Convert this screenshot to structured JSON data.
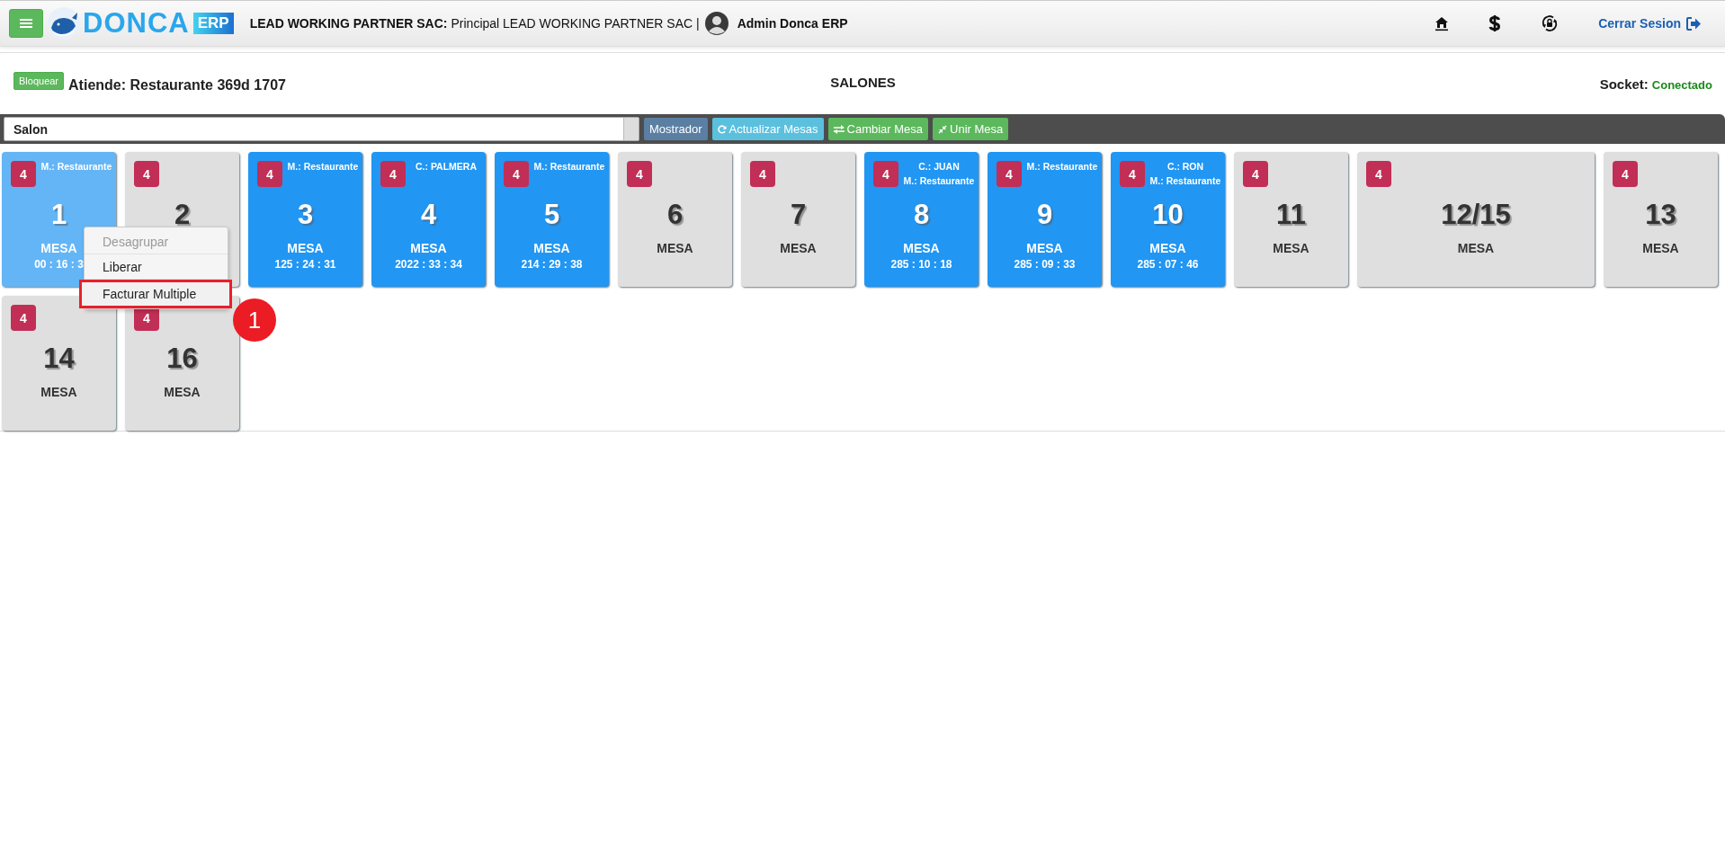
{
  "header": {
    "logo_text": "DONCA",
    "logo_badge": "ERP",
    "company_label": "LEAD WORKING PARTNER SAC:",
    "company_detail": "Principal LEAD WORKING PARTNER SAC |",
    "user": "Admin Donca ERP",
    "logout": "Cerrar Sesion"
  },
  "panel": {
    "lock_button": "Bloquear",
    "attendant": "Atiende: Restaurante 369d 1707",
    "title": "SALONES",
    "socket_label": "Socket:",
    "socket_status": "Conectado",
    "socket_connected": true
  },
  "toolbar": {
    "salon_select": "Salon",
    "buttons": [
      {
        "label": "Mostrador",
        "kind": "plain"
      },
      {
        "label": "Actualizar Mesas",
        "kind": "refresh"
      },
      {
        "label": "Cambiar Mesa",
        "kind": "exchange"
      },
      {
        "label": "Unir Mesa",
        "kind": "merge"
      }
    ]
  },
  "tables": [
    {
      "number": "1",
      "label": "MESA",
      "seats": "4",
      "occupied": true,
      "selected": true,
      "wide": false,
      "notes": [
        "M.: Restaurante"
      ],
      "time": "00 : 16 : 3"
    },
    {
      "number": "2",
      "seats": "4",
      "occupied": false,
      "selected": false,
      "wide": false
    },
    {
      "number": "3",
      "label": "MESA",
      "seats": "4",
      "occupied": true,
      "selected": false,
      "wide": false,
      "notes": [
        "M.: Restaurante"
      ],
      "time": "125 : 24 : 31"
    },
    {
      "number": "4",
      "label": "MESA",
      "seats": "4",
      "occupied": true,
      "selected": false,
      "wide": false,
      "notes": [
        "C.: PALMERA"
      ],
      "time": "2022 : 33 : 34"
    },
    {
      "number": "5",
      "label": "MESA",
      "seats": "4",
      "occupied": true,
      "selected": false,
      "wide": false,
      "notes": [
        "M.: Restaurante"
      ],
      "time": "214 : 29 : 38"
    },
    {
      "number": "6",
      "label": "MESA",
      "seats": "4",
      "occupied": false,
      "selected": false,
      "wide": false
    },
    {
      "number": "7",
      "label": "MESA",
      "seats": "4",
      "occupied": false,
      "selected": false,
      "wide": false
    },
    {
      "number": "8",
      "label": "MESA",
      "seats": "4",
      "occupied": true,
      "selected": false,
      "wide": false,
      "notes": [
        "C.: JUAN",
        "M.: Restaurante"
      ],
      "time": "285 : 10 : 18"
    },
    {
      "number": "9",
      "label": "MESA",
      "seats": "4",
      "occupied": true,
      "selected": false,
      "wide": false,
      "notes": [
        "M.: Restaurante"
      ],
      "time": "285 : 09 : 33"
    },
    {
      "number": "10",
      "label": "MESA",
      "seats": "4",
      "occupied": true,
      "selected": false,
      "wide": false,
      "notes": [
        "C.: RON",
        "M.: Restaurante"
      ],
      "time": "285 : 07 : 46"
    },
    {
      "number": "11",
      "label": "MESA",
      "seats": "4",
      "occupied": false,
      "selected": false,
      "wide": false
    },
    {
      "number": "12/15",
      "label": "MESA",
      "seats": "4",
      "occupied": false,
      "selected": false,
      "wide": true
    },
    {
      "number": "13",
      "label": "MESA",
      "seats": "4",
      "occupied": false,
      "selected": false,
      "wide": false
    },
    {
      "number": "14",
      "label": "MESA",
      "seats": "4",
      "occupied": false,
      "selected": false,
      "wide": false
    },
    {
      "number": "16",
      "label": "MESA",
      "seats": "4",
      "occupied": false,
      "selected": false,
      "wide": false
    }
  ],
  "context_menu": {
    "items": [
      {
        "label": "Desagrupar",
        "disabled": true,
        "highlighted": false
      },
      {
        "label": "Liberar",
        "disabled": false,
        "highlighted": false
      },
      {
        "label": "Facturar Multiple",
        "disabled": false,
        "highlighted": true
      }
    ],
    "annotation": "1"
  }
}
